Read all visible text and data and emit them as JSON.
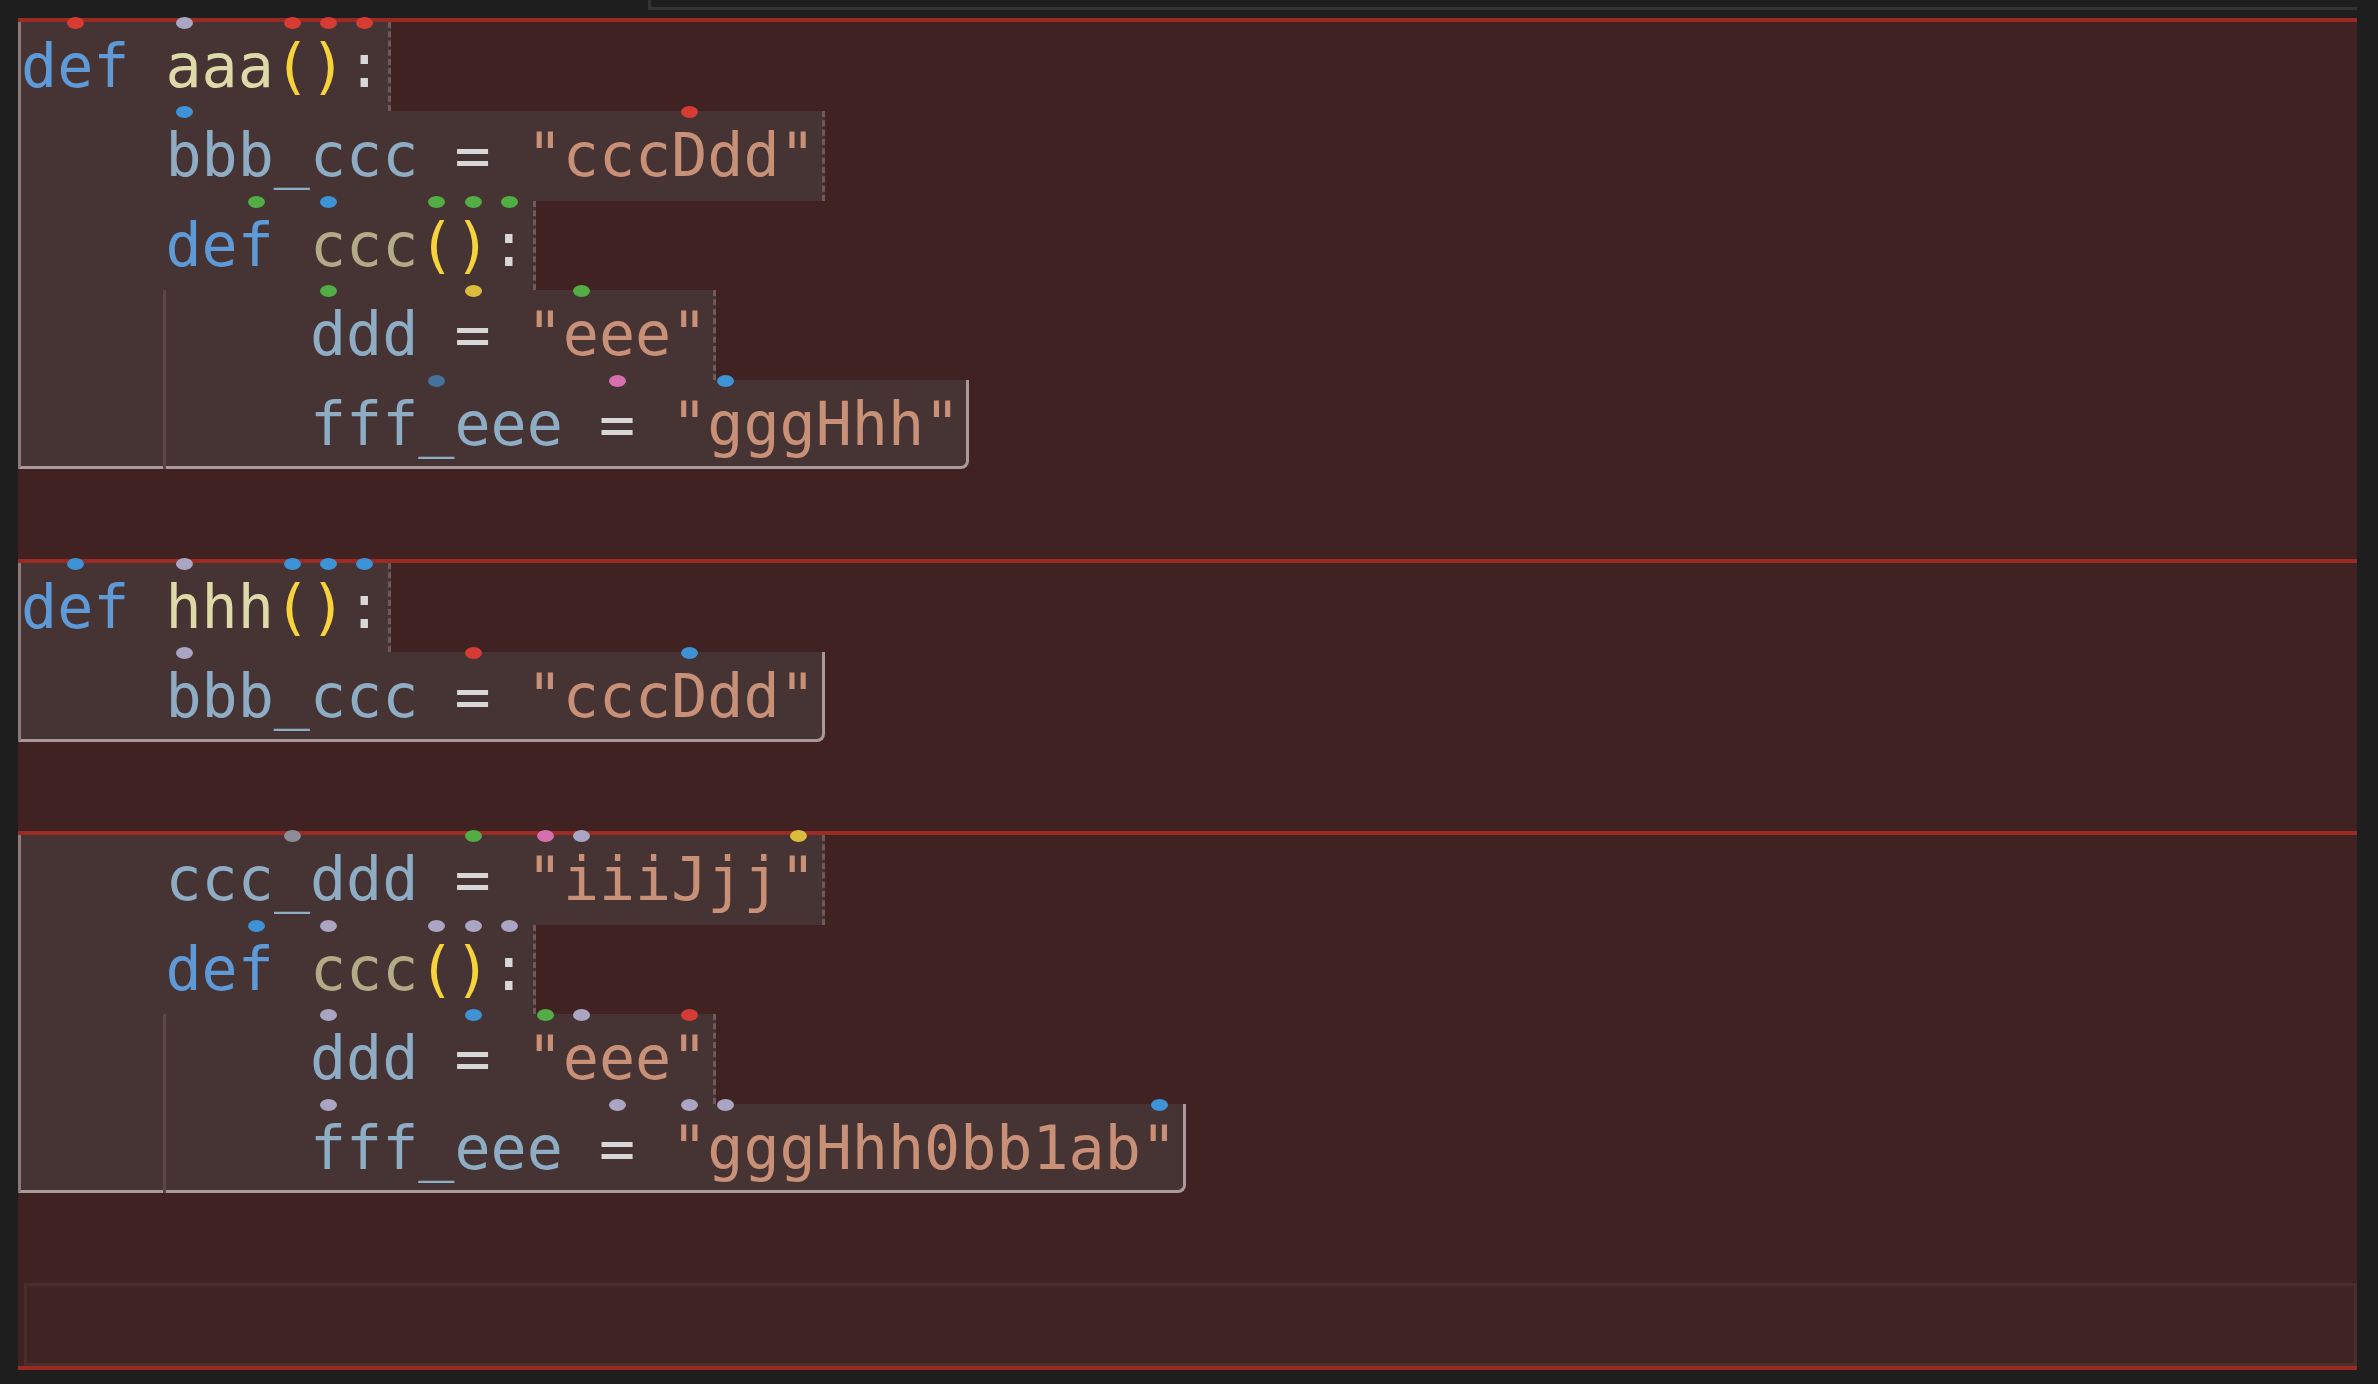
{
  "blocks": [
    {
      "lines": [
        {
          "tokens": [
            {
              "text": "d",
              "kind": "keyword"
            },
            {
              "text": "e",
              "kind": "keyword",
              "dot": {
                "color": "#d63c33"
              }
            },
            {
              "text": "f ",
              "kind": "keyword"
            },
            {
              "text": "aaa",
              "kind": "function",
              "dot": {
                "color": "#a9a5c2"
              }
            },
            {
              "text": "(",
              "kind": "paren",
              "dot": {
                "color": "#d63c33"
              }
            },
            {
              "text": ")",
              "kind": "paren",
              "dot": {
                "color": "#d63c33"
              }
            },
            {
              "text": ":",
              "kind": "punct",
              "dot": {
                "color": "#d63c33"
              }
            }
          ]
        },
        {
          "tokens": [
            {
              "text": "    bbb_ccc ",
              "kind": "name",
              "dot": {
                "color": "#3d93d6"
              }
            },
            {
              "text": "= ",
              "kind": "operator"
            },
            {
              "text": "\"ccc",
              "kind": "string"
            },
            {
              "text": "Ddd\"",
              "kind": "string",
              "dot": {
                "color": "#d63c33"
              }
            }
          ]
        },
        {
          "tokens": [
            {
              "text": "    de",
              "kind": "keyword"
            },
            {
              "text": "f ",
              "kind": "keyword",
              "dot": {
                "color": "#52ad45"
              }
            },
            {
              "text": "ccc",
              "kind": "nested_function",
              "dot": {
                "color": "#3d93d6"
              }
            },
            {
              "text": "(",
              "kind": "paren",
              "dot": {
                "color": "#52ad45"
              }
            },
            {
              "text": ")",
              "kind": "paren",
              "dot": {
                "color": "#52ad45"
              }
            },
            {
              "text": ":",
              "kind": "punct",
              "dot": {
                "color": "#52ad45"
              }
            }
          ]
        },
        {
          "tokens": [
            {
              "text": "        ddd ",
              "kind": "name",
              "dot": {
                "color": "#52ad45"
              }
            },
            {
              "text": "= ",
              "kind": "operator",
              "dot": {
                "color": "#dcbc3c"
              }
            },
            {
              "text": "\"",
              "kind": "string"
            },
            {
              "text": "eee\"",
              "kind": "string",
              "dot": {
                "color": "#52ad45"
              }
            }
          ]
        },
        {
          "tokens": [
            {
              "text": "        fff",
              "kind": "name"
            },
            {
              "text": "_eee ",
              "kind": "name",
              "dot": {
                "color": "#43739a"
              }
            },
            {
              "text": "= ",
              "kind": "operator",
              "dot": {
                "color": "#d66fae"
              }
            },
            {
              "text": "\"",
              "kind": "string"
            },
            {
              "text": "gggHhh\"",
              "kind": "string",
              "dot": {
                "color": "#3d93d6"
              }
            }
          ]
        }
      ]
    },
    {
      "lines": [
        {
          "tokens": [
            {
              "text": "d",
              "kind": "keyword"
            },
            {
              "text": "e",
              "kind": "keyword",
              "dot": {
                "color": "#3d93d6"
              }
            },
            {
              "text": "f ",
              "kind": "keyword"
            },
            {
              "text": "hhh",
              "kind": "function",
              "dot": {
                "color": "#a9a5c2"
              }
            },
            {
              "text": "(",
              "kind": "paren",
              "dot": {
                "color": "#3d93d6"
              }
            },
            {
              "text": ")",
              "kind": "paren",
              "dot": {
                "color": "#3d93d6"
              }
            },
            {
              "text": ":",
              "kind": "punct",
              "dot": {
                "color": "#3d93d6"
              }
            }
          ]
        },
        {
          "tokens": [
            {
              "text": "    bbb_ccc ",
              "kind": "name",
              "dot": {
                "color": "#a9a5c2"
              }
            },
            {
              "text": "= ",
              "kind": "operator",
              "dot": {
                "color": "#d63c33"
              }
            },
            {
              "text": "\"ccc",
              "kind": "string"
            },
            {
              "text": "Ddd\"",
              "kind": "string",
              "dot": {
                "color": "#3d93d6"
              }
            }
          ]
        }
      ]
    },
    {
      "lines": [
        {
          "tokens": [
            {
              "text": "    ccc",
              "kind": "name"
            },
            {
              "text": "_ddd ",
              "kind": "name",
              "dot": {
                "color": "#8e8c98"
              }
            },
            {
              "text": "= ",
              "kind": "operator",
              "dot": {
                "color": "#52ad45"
              }
            },
            {
              "text": "\"",
              "kind": "string",
              "dot": {
                "color": "#d66fae"
              }
            },
            {
              "text": "iiiJjj",
              "kind": "string",
              "dot": {
                "color": "#a9a5c2"
              }
            },
            {
              "text": "\"",
              "kind": "string",
              "dot": {
                "color": "#dcbc3c"
              }
            }
          ]
        },
        {
          "tokens": [
            {
              "text": "    de",
              "kind": "keyword"
            },
            {
              "text": "f ",
              "kind": "keyword",
              "dot": {
                "color": "#3d93d6"
              }
            },
            {
              "text": "ccc",
              "kind": "nested_function",
              "dot": {
                "color": "#a9a5c2"
              }
            },
            {
              "text": "(",
              "kind": "paren",
              "dot": {
                "color": "#a9a5c2"
              }
            },
            {
              "text": ")",
              "kind": "paren",
              "dot": {
                "color": "#a9a5c2"
              }
            },
            {
              "text": ":",
              "kind": "punct",
              "dot": {
                "color": "#a9a5c2"
              }
            }
          ]
        },
        {
          "tokens": [
            {
              "text": "        ddd ",
              "kind": "name",
              "dot": {
                "color": "#a9a5c2"
              }
            },
            {
              "text": "= ",
              "kind": "operator",
              "dot": {
                "color": "#3d93d6"
              }
            },
            {
              "text": "\"",
              "kind": "string",
              "dot": {
                "color": "#52ad45"
              }
            },
            {
              "text": "eee",
              "kind": "string",
              "dot": {
                "color": "#a9a5c2"
              }
            },
            {
              "text": "\"",
              "kind": "string",
              "dot": {
                "color": "#d63c33"
              }
            }
          ]
        },
        {
          "tokens": [
            {
              "text": "        fff_eee ",
              "kind": "name",
              "dot": {
                "color": "#a9a5c2"
              }
            },
            {
              "text": "= ",
              "kind": "operator",
              "dot": {
                "color": "#a9a5c2"
              }
            },
            {
              "text": "\"",
              "kind": "string",
              "dot": {
                "color": "#a9a5c2"
              }
            },
            {
              "text": "gggHhh0bb1ab",
              "kind": "string",
              "dot": {
                "color": "#a9a5c2"
              }
            },
            {
              "text": "\"",
              "kind": "string",
              "dot": {
                "color": "#3d93d6"
              }
            }
          ]
        }
      ]
    }
  ]
}
